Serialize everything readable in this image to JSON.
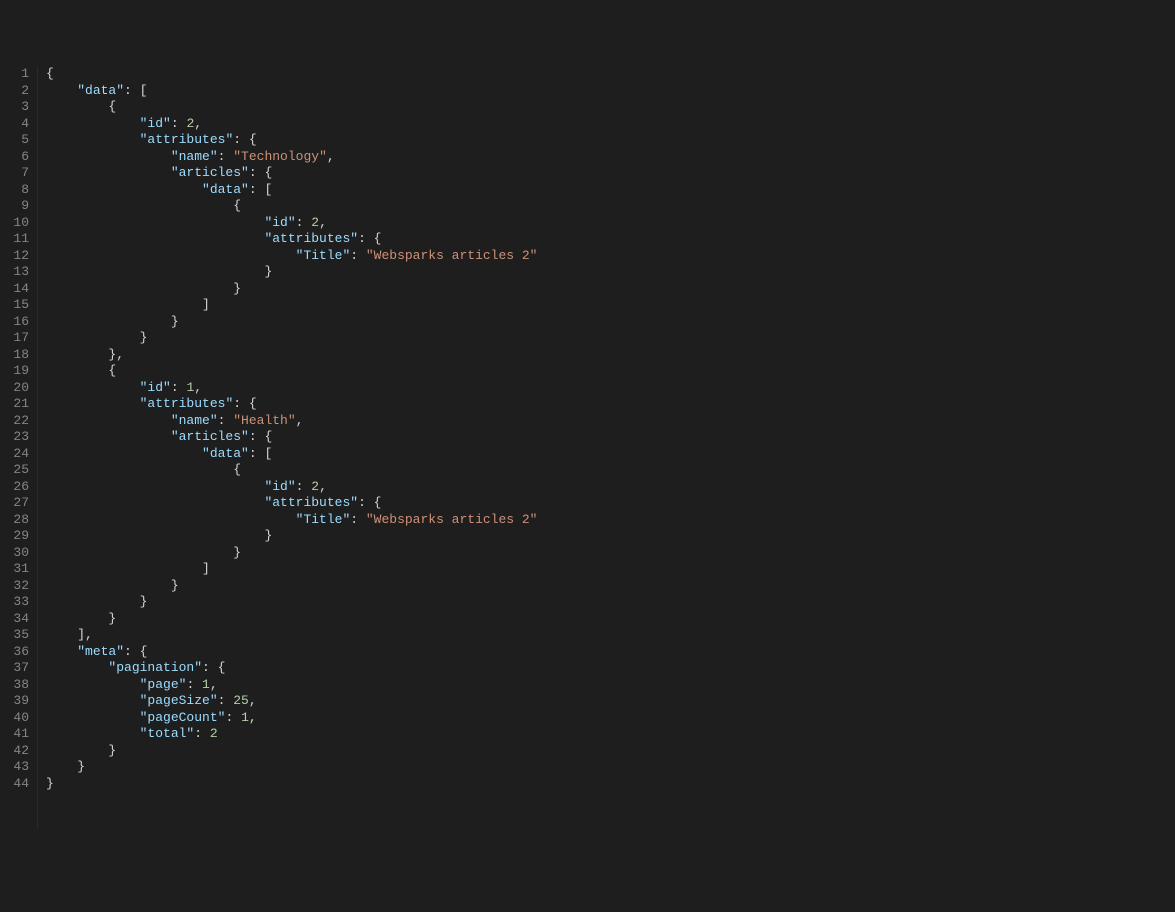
{
  "lineCount": 44,
  "json": {
    "data": [
      {
        "id": 2,
        "attributes": {
          "name": "Technology",
          "articles": {
            "data": [
              {
                "id": 2,
                "attributes": {
                  "Title": "Websparks articles 2"
                }
              }
            ]
          }
        }
      },
      {
        "id": 1,
        "attributes": {
          "name": "Health",
          "articles": {
            "data": [
              {
                "id": 2,
                "attributes": {
                  "Title": "Websparks articles 2"
                }
              }
            ]
          }
        }
      }
    ],
    "meta": {
      "pagination": {
        "page": 1,
        "pageSize": 25,
        "pageCount": 1,
        "total": 2
      }
    }
  },
  "tokens": [
    [
      [
        "p",
        "{"
      ]
    ],
    [
      [
        "sp",
        "    "
      ],
      [
        "k",
        "\"data\""
      ],
      [
        "p",
        ": ["
      ]
    ],
    [
      [
        "sp",
        "        "
      ],
      [
        "p",
        "{"
      ]
    ],
    [
      [
        "sp",
        "            "
      ],
      [
        "k",
        "\"id\""
      ],
      [
        "p",
        ": "
      ],
      [
        "n",
        "2"
      ],
      [
        "p",
        ","
      ]
    ],
    [
      [
        "sp",
        "            "
      ],
      [
        "k",
        "\"attributes\""
      ],
      [
        "p",
        ": {"
      ]
    ],
    [
      [
        "sp",
        "                "
      ],
      [
        "k",
        "\"name\""
      ],
      [
        "p",
        ": "
      ],
      [
        "s",
        "\"Technology\""
      ],
      [
        "p",
        ","
      ]
    ],
    [
      [
        "sp",
        "                "
      ],
      [
        "k",
        "\"articles\""
      ],
      [
        "p",
        ": {"
      ]
    ],
    [
      [
        "sp",
        "                    "
      ],
      [
        "k",
        "\"data\""
      ],
      [
        "p",
        ": ["
      ]
    ],
    [
      [
        "sp",
        "                        "
      ],
      [
        "p",
        "{"
      ]
    ],
    [
      [
        "sp",
        "                            "
      ],
      [
        "k",
        "\"id\""
      ],
      [
        "p",
        ": "
      ],
      [
        "n",
        "2"
      ],
      [
        "p",
        ","
      ]
    ],
    [
      [
        "sp",
        "                            "
      ],
      [
        "k",
        "\"attributes\""
      ],
      [
        "p",
        ": {"
      ]
    ],
    [
      [
        "sp",
        "                                "
      ],
      [
        "k",
        "\"Title\""
      ],
      [
        "p",
        ": "
      ],
      [
        "s",
        "\"Websparks articles 2\""
      ]
    ],
    [
      [
        "sp",
        "                            "
      ],
      [
        "p",
        "}"
      ]
    ],
    [
      [
        "sp",
        "                        "
      ],
      [
        "p",
        "}"
      ]
    ],
    [
      [
        "sp",
        "                    "
      ],
      [
        "p",
        "]"
      ]
    ],
    [
      [
        "sp",
        "                "
      ],
      [
        "p",
        "}"
      ]
    ],
    [
      [
        "sp",
        "            "
      ],
      [
        "p",
        "}"
      ]
    ],
    [
      [
        "sp",
        "        "
      ],
      [
        "p",
        "},"
      ]
    ],
    [
      [
        "sp",
        "        "
      ],
      [
        "p",
        "{"
      ]
    ],
    [
      [
        "sp",
        "            "
      ],
      [
        "k",
        "\"id\""
      ],
      [
        "p",
        ": "
      ],
      [
        "n",
        "1"
      ],
      [
        "p",
        ","
      ]
    ],
    [
      [
        "sp",
        "            "
      ],
      [
        "k",
        "\"attributes\""
      ],
      [
        "p",
        ": {"
      ]
    ],
    [
      [
        "sp",
        "                "
      ],
      [
        "k",
        "\"name\""
      ],
      [
        "p",
        ": "
      ],
      [
        "s",
        "\"Health\""
      ],
      [
        "p",
        ","
      ]
    ],
    [
      [
        "sp",
        "                "
      ],
      [
        "k",
        "\"articles\""
      ],
      [
        "p",
        ": {"
      ]
    ],
    [
      [
        "sp",
        "                    "
      ],
      [
        "k",
        "\"data\""
      ],
      [
        "p",
        ": ["
      ]
    ],
    [
      [
        "sp",
        "                        "
      ],
      [
        "p",
        "{"
      ]
    ],
    [
      [
        "sp",
        "                            "
      ],
      [
        "k",
        "\"id\""
      ],
      [
        "p",
        ": "
      ],
      [
        "n",
        "2"
      ],
      [
        "p",
        ","
      ]
    ],
    [
      [
        "sp",
        "                            "
      ],
      [
        "k",
        "\"attributes\""
      ],
      [
        "p",
        ": {"
      ]
    ],
    [
      [
        "sp",
        "                                "
      ],
      [
        "k",
        "\"Title\""
      ],
      [
        "p",
        ": "
      ],
      [
        "s",
        "\"Websparks articles 2\""
      ]
    ],
    [
      [
        "sp",
        "                            "
      ],
      [
        "p",
        "}"
      ]
    ],
    [
      [
        "sp",
        "                        "
      ],
      [
        "p",
        "}"
      ]
    ],
    [
      [
        "sp",
        "                    "
      ],
      [
        "p",
        "]"
      ]
    ],
    [
      [
        "sp",
        "                "
      ],
      [
        "p",
        "}"
      ]
    ],
    [
      [
        "sp",
        "            "
      ],
      [
        "p",
        "}"
      ]
    ],
    [
      [
        "sp",
        "        "
      ],
      [
        "p",
        "}"
      ]
    ],
    [
      [
        "sp",
        "    "
      ],
      [
        "p",
        "],"
      ]
    ],
    [
      [
        "sp",
        "    "
      ],
      [
        "k",
        "\"meta\""
      ],
      [
        "p",
        ": {"
      ]
    ],
    [
      [
        "sp",
        "        "
      ],
      [
        "k",
        "\"pagination\""
      ],
      [
        "p",
        ": {"
      ]
    ],
    [
      [
        "sp",
        "            "
      ],
      [
        "k",
        "\"page\""
      ],
      [
        "p",
        ": "
      ],
      [
        "n",
        "1"
      ],
      [
        "p",
        ","
      ]
    ],
    [
      [
        "sp",
        "            "
      ],
      [
        "k",
        "\"pageSize\""
      ],
      [
        "p",
        ": "
      ],
      [
        "n",
        "25"
      ],
      [
        "p",
        ","
      ]
    ],
    [
      [
        "sp",
        "            "
      ],
      [
        "k",
        "\"pageCount\""
      ],
      [
        "p",
        ": "
      ],
      [
        "n",
        "1"
      ],
      [
        "p",
        ","
      ]
    ],
    [
      [
        "sp",
        "            "
      ],
      [
        "k",
        "\"total\""
      ],
      [
        "p",
        ": "
      ],
      [
        "n",
        "2"
      ]
    ],
    [
      [
        "sp",
        "        "
      ],
      [
        "p",
        "}"
      ]
    ],
    [
      [
        "sp",
        "    "
      ],
      [
        "p",
        "}"
      ]
    ],
    [
      [
        "p",
        "}"
      ]
    ]
  ]
}
